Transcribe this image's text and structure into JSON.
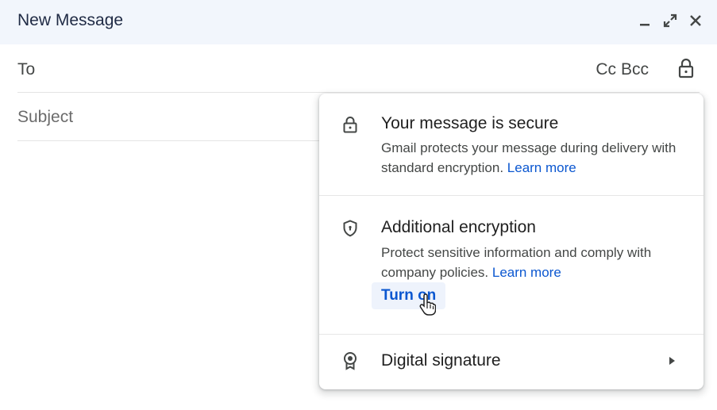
{
  "header": {
    "title": "New Message"
  },
  "compose": {
    "to_label": "To",
    "cc_label": "Cc",
    "bcc_label": "Bcc",
    "subject_placeholder": "Subject"
  },
  "popup": {
    "secure": {
      "title": "Your message is secure",
      "body": "Gmail protects your message during delivery with standard encryption.",
      "link": "Learn more"
    },
    "encryption": {
      "title": "Additional encryption",
      "body": "Protect sensitive information and comply with company policies.",
      "link": "Learn more",
      "button": "Turn on"
    },
    "signature": {
      "title": "Digital signature"
    }
  },
  "colors": {
    "header_bg": "#f2f6fc",
    "link": "#0b57d0"
  },
  "icons": [
    "minimize-icon",
    "expand-icon",
    "close-icon",
    "lock-icon",
    "shield-icon",
    "badge-icon",
    "chevron-right-icon",
    "hand-cursor-icon"
  ]
}
